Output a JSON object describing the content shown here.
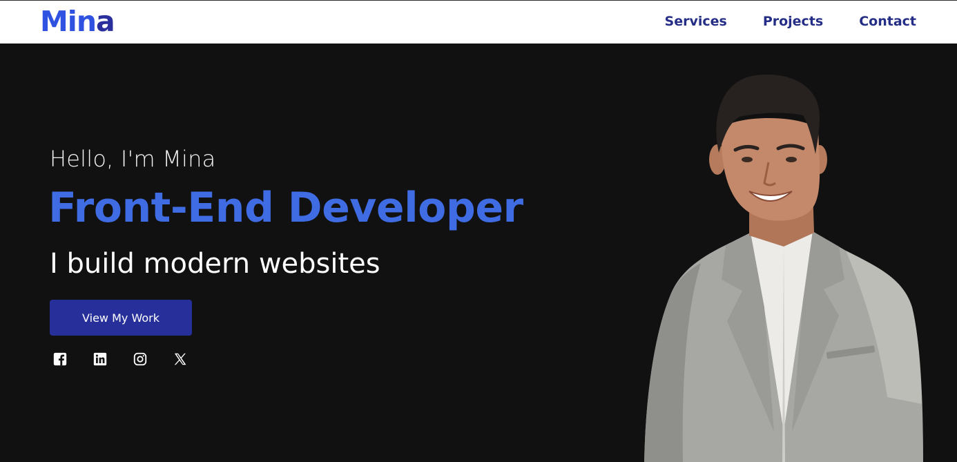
{
  "brand": {
    "logo_main": "Min",
    "logo_accent": "a"
  },
  "nav": {
    "items": [
      {
        "label": "Services"
      },
      {
        "label": "Projects"
      },
      {
        "label": "Contact"
      }
    ]
  },
  "hero": {
    "greeting": "Hello, I'm Mina",
    "headline": "Front-End Developer",
    "subline": "I build modern websites",
    "cta_label": "View My Work",
    "socials": [
      {
        "icon": "facebook-icon"
      },
      {
        "icon": "linkedin-icon"
      },
      {
        "icon": "instagram-icon"
      },
      {
        "icon": "x-icon"
      }
    ],
    "portrait": "photo of smiling man in grey blazer"
  },
  "colors": {
    "background": "#111112",
    "navbar": "#ffffff",
    "nav_text": "#252e87",
    "accent_blue": "#3f6ce3",
    "button": "#27309a"
  }
}
